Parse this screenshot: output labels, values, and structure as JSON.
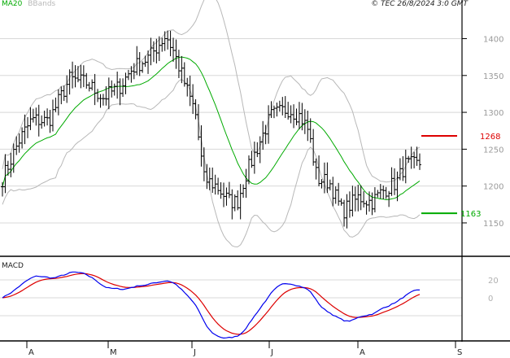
{
  "legend": {
    "ma20": "MA20",
    "bbands": "BBands"
  },
  "copyright": "© TEC 26/8/2024 3:0 GMT",
  "colors": {
    "ma": "#00aa00",
    "bands": "#b8b8b8",
    "price": "#000000",
    "macd": "#0000ee",
    "signal": "#dd0000",
    "resistance": "#dd0000",
    "support": "#00aa00",
    "grid": "#d8d8d8"
  },
  "chart_data": [
    {
      "type": "ohlc",
      "title": "",
      "y_ticks": [
        "1400",
        "1350",
        "1300",
        "1250",
        "1200",
        "1150"
      ],
      "x_ticks": [
        "A",
        "M",
        "J",
        "J",
        "A",
        "S"
      ],
      "ylim": [
        1108,
        1448
      ],
      "grid": true,
      "series": [
        {
          "name": "MA20",
          "start": 1170,
          "end": 1197,
          "peak": 1355
        },
        {
          "name": "BBands",
          "upper_peak": 1435,
          "lower_min": 1128
        }
      ],
      "levels": [
        {
          "label": "1268",
          "value": 1268,
          "color": "resistance"
        },
        {
          "label": "1163",
          "value": 1163,
          "color": "support"
        }
      ],
      "price_summary": {
        "first_close": 1215,
        "high": 1436,
        "low": 1154,
        "last_close": 1229
      }
    },
    {
      "type": "line",
      "title": "MACD",
      "y_ticks": [
        "20",
        "0"
      ],
      "series": [
        {
          "name": "MACD",
          "color": "macd"
        },
        {
          "name": "Signal",
          "color": "signal"
        }
      ]
    }
  ]
}
